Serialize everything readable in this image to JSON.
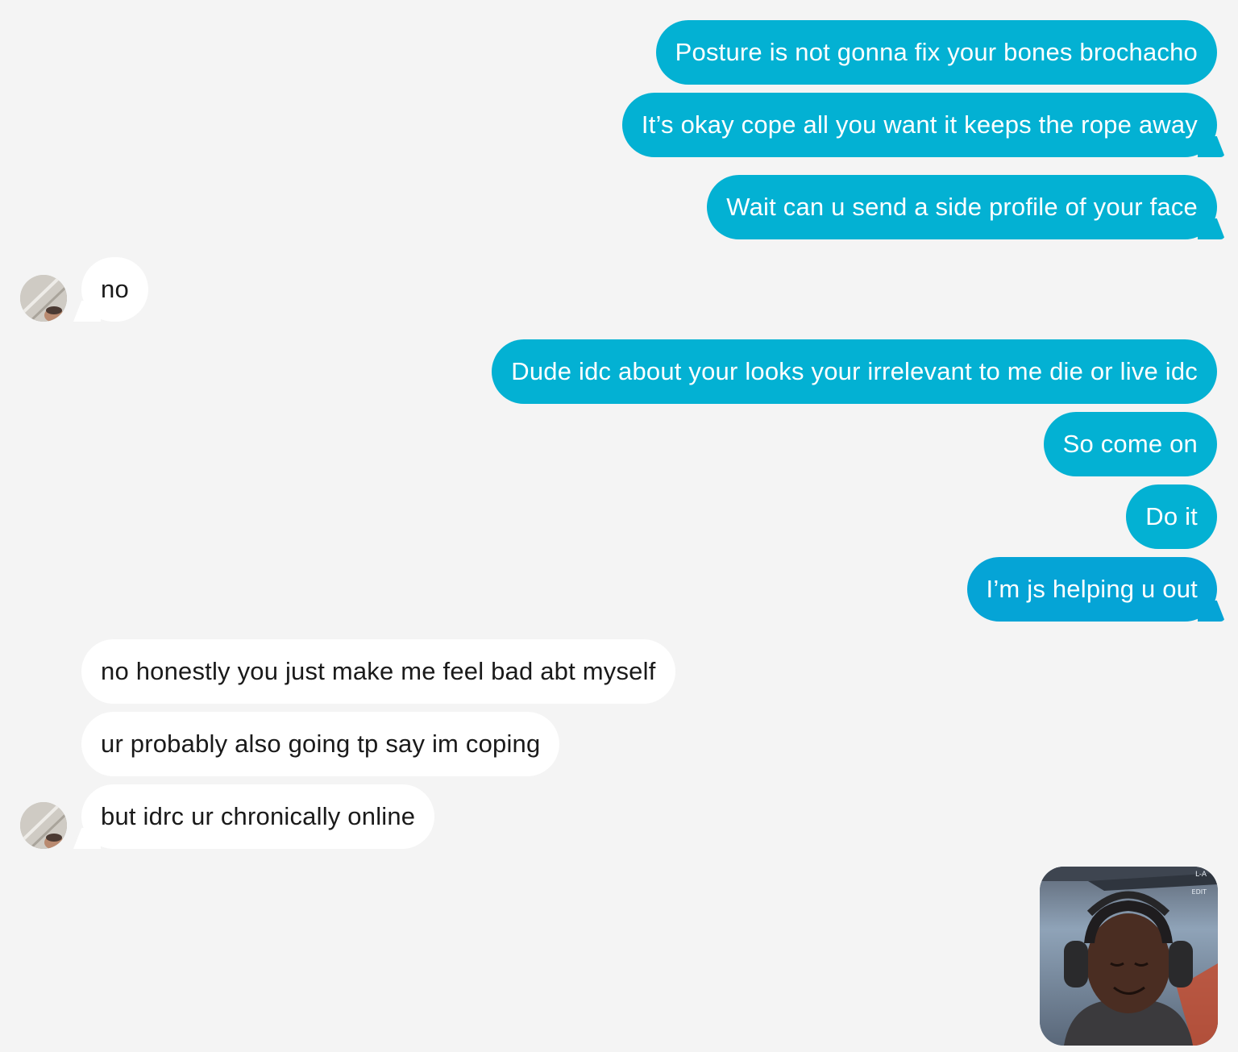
{
  "conversation": {
    "messages": [
      {
        "direction": "outgoing",
        "text": "Posture is not gonna fix your bones brochacho"
      },
      {
        "direction": "outgoing",
        "text": "It’s okay cope all you want it keeps the rope away"
      },
      {
        "direction": "outgoing",
        "text": "Wait can u send a side profile of your face"
      },
      {
        "direction": "incoming",
        "text": "no"
      },
      {
        "direction": "outgoing",
        "text": "Dude idc about your looks your irrelevant to me die or live idc"
      },
      {
        "direction": "outgoing",
        "text": "So come on"
      },
      {
        "direction": "outgoing",
        "text": "Do it"
      },
      {
        "direction": "outgoing",
        "text": "I’m js helping u out"
      },
      {
        "direction": "incoming",
        "text": "no honestly you just make me feel bad abt myself"
      },
      {
        "direction": "incoming",
        "text": "ur probably also going tp say im coping"
      },
      {
        "direction": "incoming",
        "text": "but idrc ur chronically online"
      }
    ],
    "attachment": {
      "type": "image",
      "overlay_text_1": "L-A",
      "overlay_text_2": "EDIT"
    }
  },
  "colors": {
    "background": "#f4f4f4",
    "outgoing_bubble": "#03b1d3",
    "outgoing_bubble_last": "#05a4d6",
    "incoming_bubble": "#ffffff",
    "outgoing_text": "#ffffff",
    "incoming_text": "#1a1a1a"
  }
}
